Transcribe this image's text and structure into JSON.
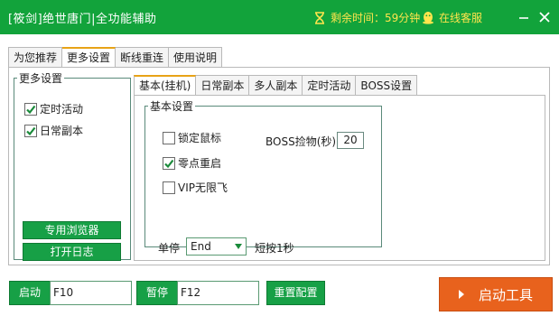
{
  "window": {
    "title": "[筱剑]绝世唐门|全功能辅助",
    "timer_text": "剩余时间：59分钟",
    "service_text": "在线客服"
  },
  "main_tabs": [
    "为您推荐",
    "更多设置",
    "断线重连",
    "使用说明"
  ],
  "more_settings": {
    "legend": "更多设置",
    "checkboxes": [
      {
        "label": "定时活动",
        "checked": true
      },
      {
        "label": "日常副本",
        "checked": true
      }
    ],
    "browser_button": "专用浏览器",
    "log_button": "打开日志"
  },
  "sub_tabs": [
    "基本(挂机)",
    "日常副本",
    "多人副本",
    "定时活动",
    "BOSS设置"
  ],
  "basic": {
    "legend": "基本设置",
    "checkboxes": [
      {
        "label": "锁定鼠标",
        "checked": false
      },
      {
        "label": "零点重启",
        "checked": true
      },
      {
        "label": "VIP无限飞",
        "checked": false
      }
    ],
    "boss_label": "BOSS捡物(秒)",
    "boss_value": "20",
    "stop_label": "单停",
    "stop_key": "End",
    "hint": "短按1秒"
  },
  "bottom": {
    "start_label": "启动",
    "start_key": "F10",
    "pause_label": "暂停",
    "pause_key": "F12",
    "reset_button": "重置配置",
    "launch_button": "启动工具"
  },
  "colors": {
    "brand_green": "#12a33b",
    "button_green": "#17a046",
    "accent_yellow": "#ffe54d",
    "launch_orange": "#e8621d",
    "tab_accent": "#e8a317"
  },
  "icons": {
    "timer": "hourglass-icon",
    "service": "qq-penguin-icon",
    "minimize": "minimize-icon",
    "close": "close-icon",
    "launch": "play-triangle-icon"
  }
}
